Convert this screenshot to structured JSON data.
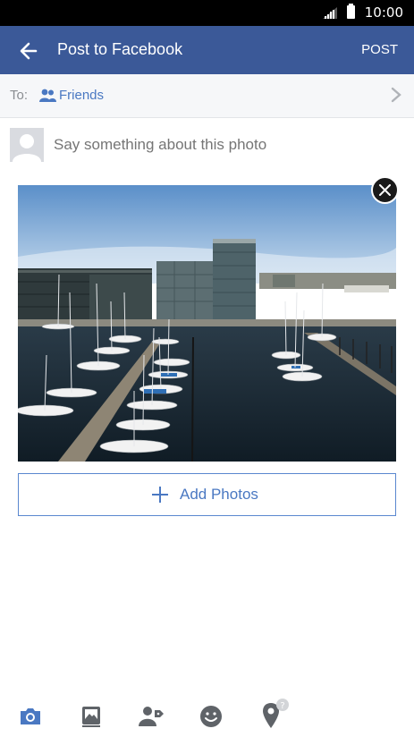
{
  "status_bar": {
    "time": "10:00"
  },
  "app_bar": {
    "title": "Post to Facebook",
    "post_label": "POST"
  },
  "audience": {
    "to_label": "To:",
    "value": "Friends"
  },
  "composer": {
    "placeholder": "Say something about this photo"
  },
  "add_photos": {
    "label": "Add Photos"
  },
  "toolbar": {
    "items": [
      "camera-icon",
      "gallery-icon",
      "tag-people-icon",
      "feeling-icon",
      "location-icon"
    ]
  },
  "colors": {
    "brand": "#3b5998",
    "accent": "#4a78c2",
    "status_bar": "#000000"
  }
}
